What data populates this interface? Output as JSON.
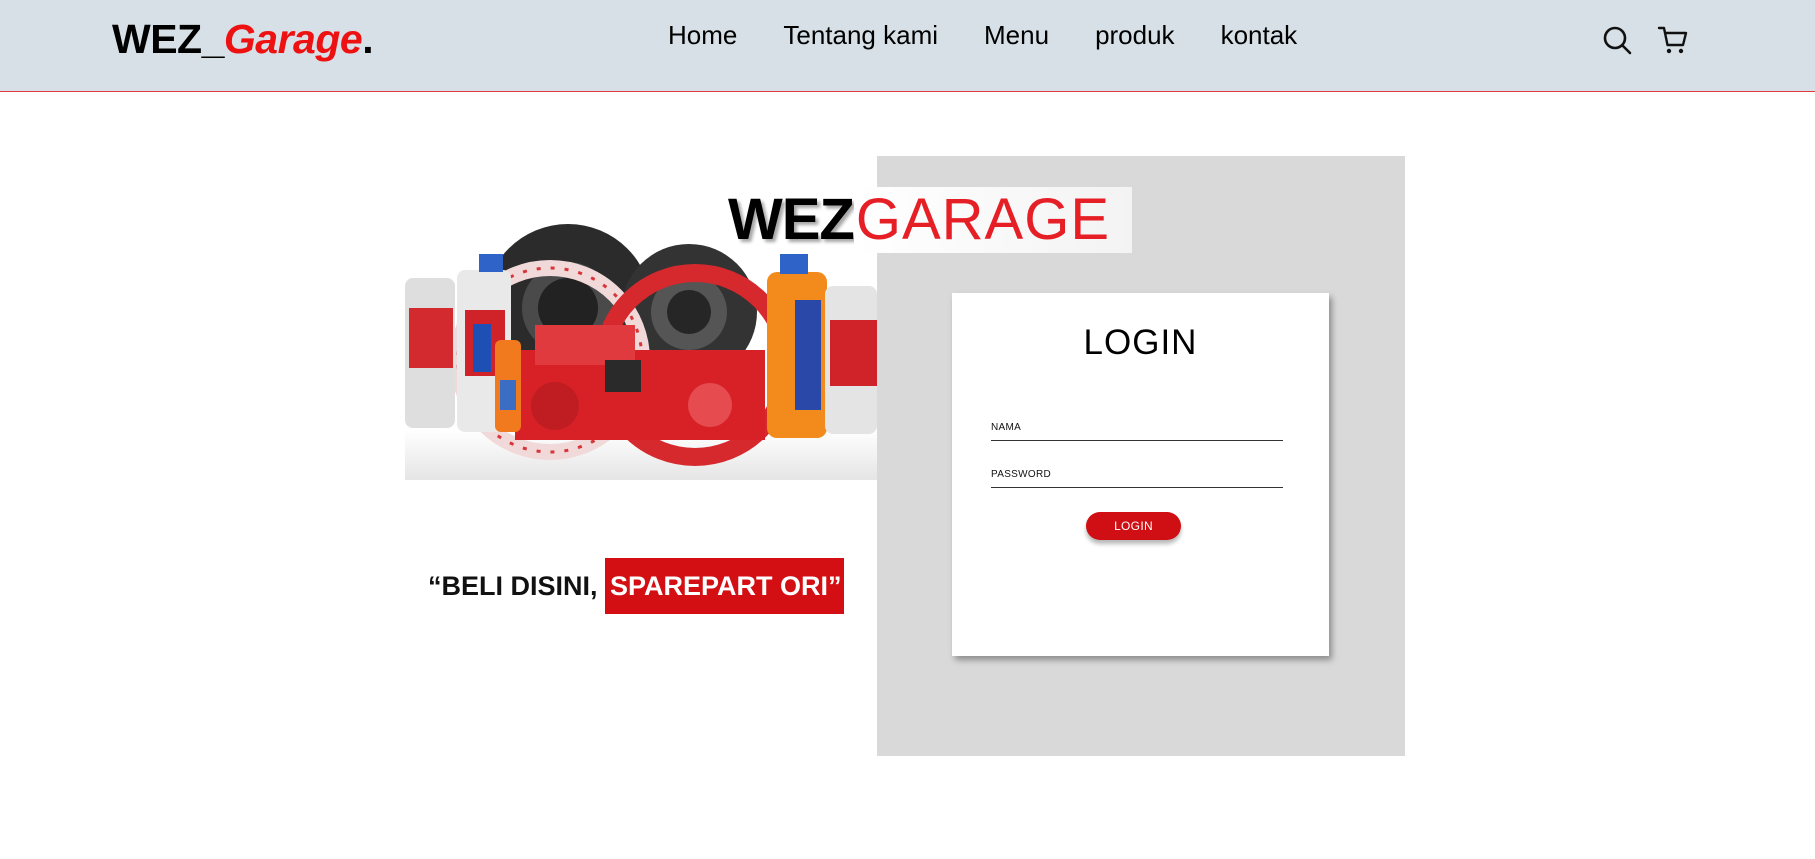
{
  "header": {
    "brand_main": "WEZ_",
    "brand_accent": "Garage",
    "brand_suffix": ".",
    "nav": [
      "Home",
      "Tentang kami",
      "Menu",
      "produk",
      "kontak"
    ]
  },
  "hero": {
    "logo_black": "WEZ",
    "logo_red": "GARAGE",
    "tagline_plain": "“BELI DISINI,",
    "tagline_highlight": "SPAREPART ORI”"
  },
  "login": {
    "title": "LOGIN",
    "nama_placeholder": "NAMA",
    "password_placeholder": "PASSWORD",
    "button_label": "LOGIN"
  },
  "colors": {
    "accent_red": "#d30f14",
    "navbar_bg": "#d6e0e6",
    "panel_gray": "#d9d9d9"
  },
  "icons": {
    "search": "search-icon",
    "cart": "cart-icon"
  }
}
